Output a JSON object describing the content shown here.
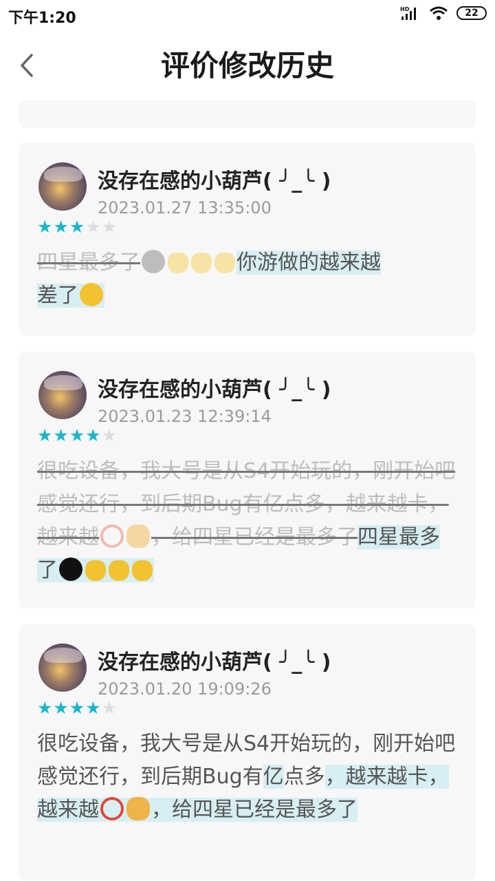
{
  "status_bar": {
    "time": "下午1:20",
    "network": "HD",
    "battery": "22"
  },
  "header": {
    "title": "评价修改历史",
    "back_icon": "chevron-left-icon"
  },
  "reviews": [
    {
      "username": "没存在感的小葫芦( ╯_╰ )",
      "timestamp": "2023.01.27 13:35:00",
      "rating": 3,
      "max_rating": 5,
      "deleted_text": "四星最多了",
      "inserted_text_1": "你游做的越来越",
      "inserted_text_2": "差了"
    },
    {
      "username": "没存在感的小葫芦( ╯_╰ )",
      "timestamp": "2023.01.23 12:39:14",
      "rating": 4,
      "max_rating": 5,
      "deleted_text": "很吃设备，我大号是从S4开始玩的，刚开始吧感觉还行，到后期Bug有亿点多，越来越卡，越来越",
      "deleted_text_2": "，给四星已经是最多了",
      "inserted_text": "四星最多了"
    },
    {
      "username": "没存在感的小葫芦( ╯_╰ )",
      "timestamp": "2023.01.20 19:09:26",
      "rating": 4,
      "max_rating": 5,
      "plain_text": "很吃设备，我大号是从S4开始玩的，刚开始吧感觉还行，到后期Bug有",
      "inserted_1": "亿",
      "plain_text_2": "点多",
      "inserted_2": "，越来越卡，越来越",
      "inserted_3": "，给四星已经是最多了"
    }
  ],
  "colors": {
    "star_on": "#1bb6c8",
    "star_off": "#dedede",
    "insert_highlight": "#d7eef2",
    "card_bg": "#f7f7f7"
  }
}
